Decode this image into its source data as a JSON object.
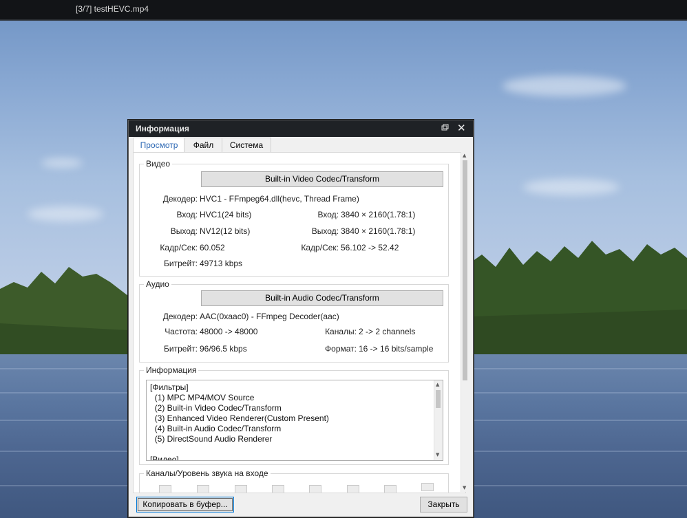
{
  "topbar": {
    "title": "[3/7] testHEVC.mp4"
  },
  "dialog": {
    "title": "Информация",
    "tabs": [
      {
        "label": "Просмотр",
        "active": true
      },
      {
        "label": "Файл",
        "active": false
      },
      {
        "label": "Система",
        "active": false
      }
    ],
    "video": {
      "group_title": "Видео",
      "codec_button": "Built-in Video Codec/Transform",
      "decoder_label": "Декодер:",
      "decoder_value": "HVC1 - FFmpeg64.dll(hevc, Thread Frame)",
      "input_label": "Вход:",
      "input_value": "HVC1(24 bits)",
      "input_size_label": "Вход:",
      "input_size_value": "3840 × 2160(1.78:1)",
      "output_label": "Выход:",
      "output_value": "NV12(12 bits)",
      "output_size_label": "Выход:",
      "output_size_value": "3840 × 2160(1.78:1)",
      "fps_label": "Кадр/Сек:",
      "fps_value": "60.052",
      "fps2_label": "Кадр/Сек:",
      "fps2_value": "56.102 -> 52.42",
      "bitrate_label": "Битрейт:",
      "bitrate_value": "49713 kbps"
    },
    "audio": {
      "group_title": "Аудио",
      "codec_button": "Built-in Audio Codec/Transform",
      "decoder_label": "Декодер:",
      "decoder_value": "AAC(0xaac0) - FFmpeg Decoder(aac)",
      "freq_label": "Частота:",
      "freq_value": "48000 -> 48000",
      "channels_label": "Каналы:",
      "channels_value": "2 -> 2 channels",
      "bitrate_label": "Битрейт:",
      "bitrate_value": "96/96.5 kbps",
      "format_label": "Формат:",
      "format_value": "16 -> 16 bits/sample"
    },
    "info": {
      "group_title": "Информация",
      "lines": [
        "[Фильтры]",
        "  (1) MPC MP4/MOV Source",
        "  (2) Built-in Video Codec/Transform",
        "  (3) Enhanced Video Renderer(Custom Present)",
        "  (4) Built-in Audio Codec/Transform",
        "  (5) DirectSound Audio Renderer",
        "",
        "[Видео]"
      ]
    },
    "levels": {
      "group_title": "Каналы/Уровень звука на входе"
    },
    "buttons": {
      "copy": "Копировать в буфер...",
      "close": "Закрыть"
    }
  }
}
